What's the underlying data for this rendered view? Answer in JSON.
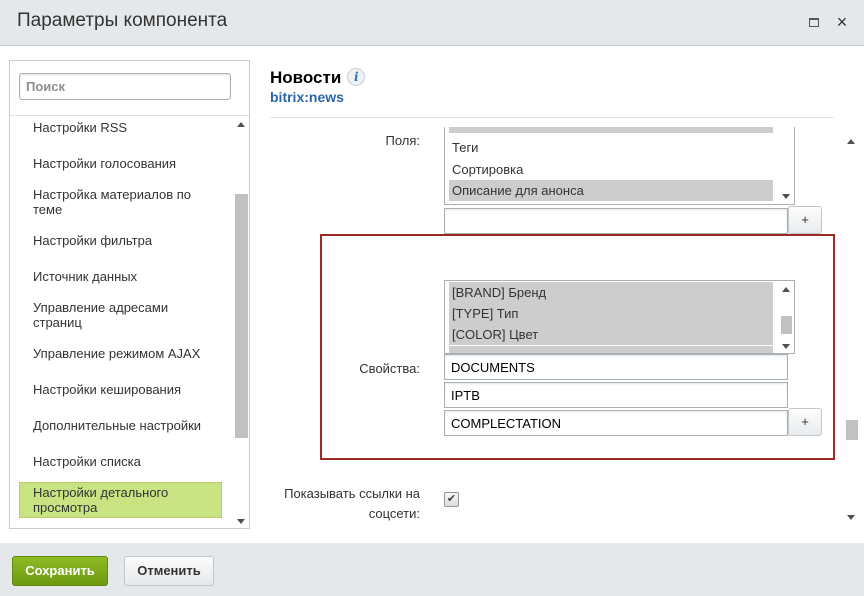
{
  "window": {
    "title": "Параметры компонента",
    "maximize_icon": "maximize-icon",
    "close_icon": "close-icon",
    "close_glyph": "×"
  },
  "sidebar": {
    "search_placeholder": "Поиск",
    "items": [
      {
        "label": "Настройки RSS"
      },
      {
        "label": "Настройки голосования"
      },
      {
        "label": "Настройка материалов по теме"
      },
      {
        "label": "Настройки фильтра"
      },
      {
        "label": "Источник данных"
      },
      {
        "label": "Управление адресами страниц"
      },
      {
        "label": "Управление режимом AJAX"
      },
      {
        "label": "Настройки кеширования"
      },
      {
        "label": "Дополнительные настройки"
      },
      {
        "label": "Настройки списка"
      },
      {
        "label": "Настройки детального просмотра",
        "active": true
      }
    ],
    "active_color": "#c9e282"
  },
  "component": {
    "title": "Новости",
    "code": "bitrix:news",
    "info_glyph": "i"
  },
  "fields": {
    "label": "Поля:",
    "options": [
      {
        "label": "Теги",
        "selected": false
      },
      {
        "label": "Сортировка",
        "selected": false
      },
      {
        "label": "Описание для анонса",
        "selected": true
      }
    ],
    "extra_input": "",
    "add_label": "+"
  },
  "properties": {
    "label": "Свойства:",
    "options": [
      {
        "label": "[BRAND] Бренд",
        "selected": true
      },
      {
        "label": "[TYPE] Тип",
        "selected": true
      },
      {
        "label": "[COLOR] Цвет",
        "selected": true
      }
    ],
    "inputs": [
      "DOCUMENTS",
      "IPTB",
      "COMPLECTATION"
    ],
    "add_label": "+",
    "highlight_color": "#9b2a24"
  },
  "show_social": {
    "label_line1": "Показывать ссылки на",
    "label_line2": "соцсети:",
    "checked": true,
    "check_glyph": "✔"
  },
  "footer": {
    "save_label": "Сохранить",
    "cancel_label": "Отменить",
    "save_color": "#7aa81a"
  }
}
